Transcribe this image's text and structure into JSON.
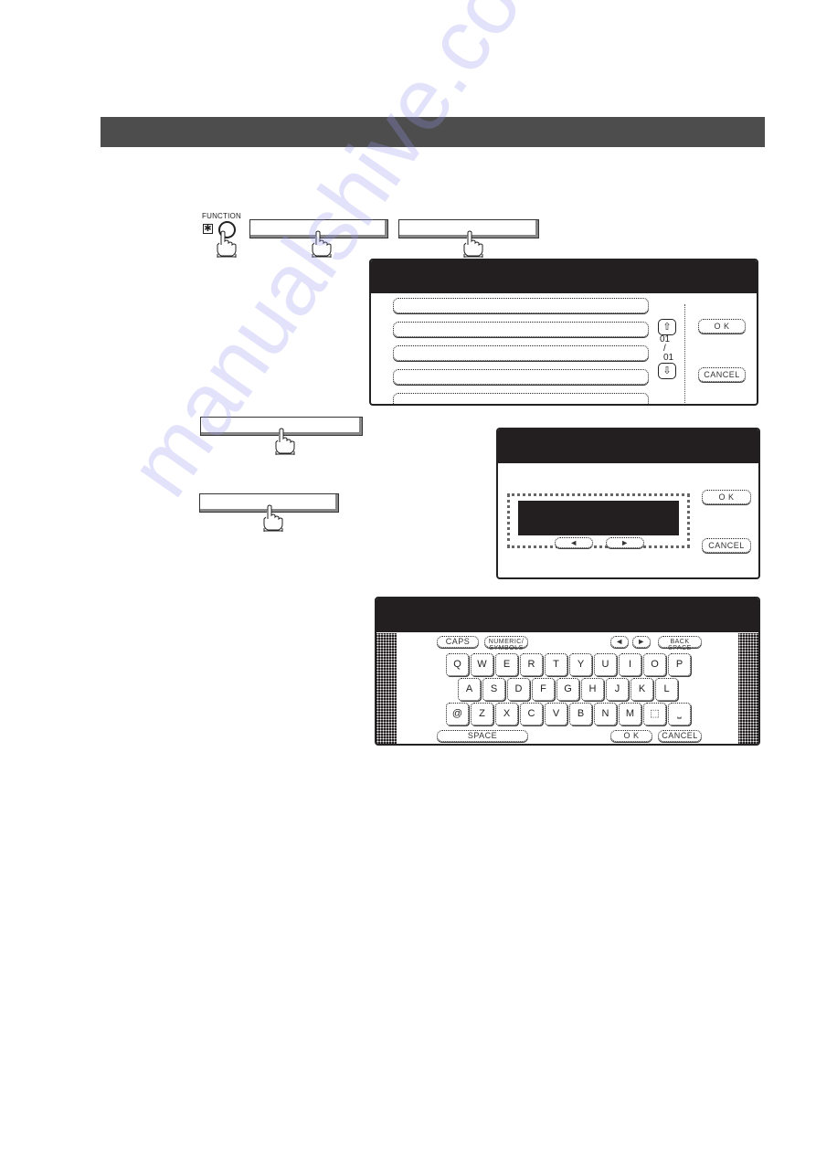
{
  "header": {
    "title": ""
  },
  "function_key": {
    "label": "FUNCTION",
    "key_symbol": "✱"
  },
  "panels": {
    "select_list": {
      "pager": {
        "up_icon": "⇧",
        "current": "01",
        "separator": "/",
        "total": "01",
        "down_icon": "⇩"
      },
      "ok_label": "O K",
      "cancel_label": "CANCEL",
      "rows": 5
    },
    "entry": {
      "left_label": "◄",
      "right_label": "►",
      "ok_label": "O K",
      "cancel_label": "CANCEL"
    },
    "keyboard": {
      "caps_label": "CAPS",
      "numeric_line1": "NUMERIC/",
      "numeric_line2": "SYMBOLS",
      "left_label": "◄",
      "right_label": "►",
      "back_line1": "BACK",
      "back_line2": "SPACE",
      "row1": [
        "Q",
        "W",
        "E",
        "R",
        "T",
        "Y",
        "U",
        "I",
        "O",
        "P"
      ],
      "row2": [
        "A",
        "S",
        "D",
        "F",
        "G",
        "H",
        "J",
        "K",
        "L"
      ],
      "row3": [
        "@",
        "Z",
        "X",
        "C",
        "V",
        "B",
        "N",
        "M",
        "⬚",
        "⎵"
      ],
      "space_label": "SPACE",
      "ok_label": "O K",
      "cancel_label": "CANCEL"
    }
  },
  "watermark": "manualshive.com"
}
